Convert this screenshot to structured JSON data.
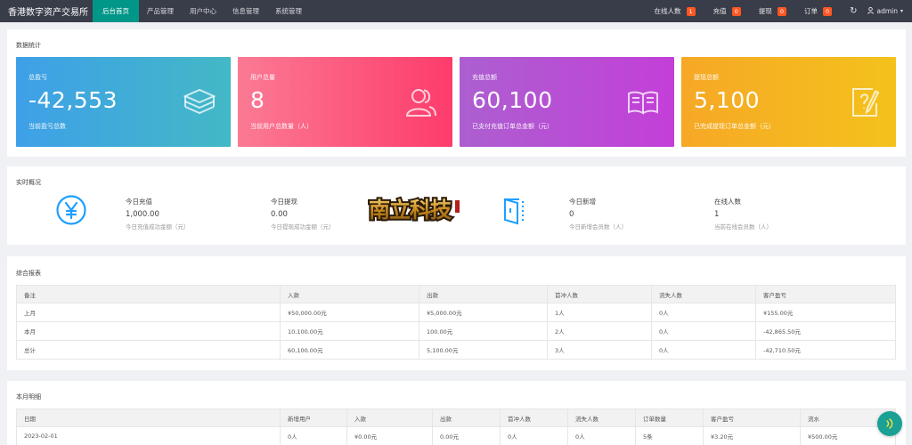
{
  "topbar": {
    "brand": "香港数字资产交易所",
    "nav": [
      "后台首页",
      "产品管理",
      "用户中心",
      "信息管理",
      "系统管理"
    ],
    "stats": [
      {
        "label": "在线人数",
        "count": "1"
      },
      {
        "label": "充值",
        "count": "0"
      },
      {
        "label": "提现",
        "count": "0"
      },
      {
        "label": "订单",
        "count": "0"
      }
    ],
    "refresh_icon": "↻",
    "user_icon": "⚲",
    "username": "admin",
    "caret": "▾"
  },
  "stats_panel": {
    "title": "数据统计",
    "cards": [
      {
        "label": "总盈亏",
        "value": "-42,553",
        "desc": "当前盈亏总数",
        "icon": "layers-icon"
      },
      {
        "label": "用户总量",
        "value": "8",
        "desc": "当前用户总数量（人）",
        "icon": "users-icon"
      },
      {
        "label": "充值总额",
        "value": "60,100",
        "desc": "已支付充值订单总金额（元）",
        "icon": "book-icon"
      },
      {
        "label": "提现总额",
        "value": "5,100",
        "desc": "已完成提现订单总金额（元）",
        "icon": "edit-icon"
      }
    ]
  },
  "realtime": {
    "title": "实时概况",
    "yuan_icon": "¥",
    "logo_text": "南立科技",
    "items": [
      {
        "label": "今日充值",
        "value": "1,000.00",
        "desc": "今日充值成功金额（元）"
      },
      {
        "label": "今日提现",
        "value": "0.00",
        "desc": "今日提现成功金额（元）"
      },
      {
        "label": "今日新增",
        "value": "0",
        "desc": "今日新增会员数（人）"
      },
      {
        "label": "在线人数",
        "value": "1",
        "desc": "当前在线会员数（人）"
      }
    ]
  },
  "summary": {
    "title": "综合报表",
    "headers": [
      "备注",
      "入款",
      "出款",
      "首冲人数",
      "流失人数",
      "客户盈亏"
    ],
    "rows": [
      [
        "上月",
        "¥50,000.00元",
        "¥5,000.00元",
        "1人",
        "0人",
        "¥155.00元"
      ],
      [
        "本月",
        "10,100.00元",
        "100.00元",
        "2人",
        "0人",
        "-42,865.50元"
      ],
      [
        "总计",
        "60,100.00元",
        "5,100.00元",
        "3人",
        "0人",
        "-42,710.50元"
      ]
    ]
  },
  "monthly": {
    "title": "本月明细",
    "headers": [
      "日期",
      "新增用户",
      "入款",
      "出款",
      "首冲人数",
      "流失人数",
      "订单数量",
      "客户盈亏",
      "流水"
    ],
    "rows": [
      [
        "2023-02-01",
        "0人",
        "¥0.00元",
        "0.00元",
        "0人",
        "0人",
        "5条",
        "¥3.20元",
        "¥500.00元"
      ]
    ]
  },
  "colors": {
    "topbar": "#393d49",
    "active_nav": "#009688",
    "badge": "#ff5722",
    "accent_icon": "#1e9fff"
  }
}
